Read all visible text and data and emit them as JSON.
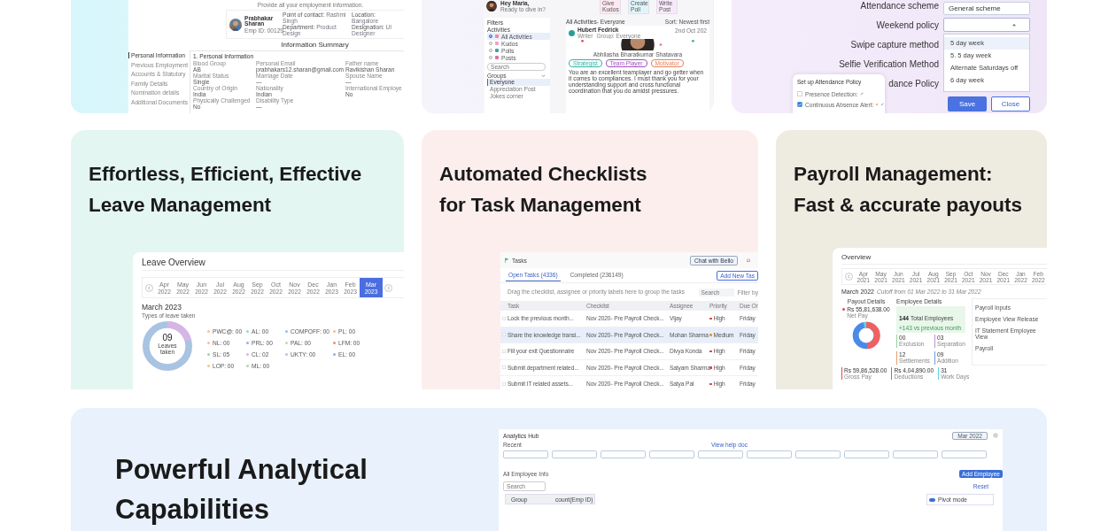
{
  "employment_info": {
    "subtitle": "Provide all your employment information.",
    "employee": {
      "name": "Prabhakar Sharan",
      "emp_id": "Emp ID: 00129",
      "details": [
        {
          "label": "Point of contact:",
          "value": "Rashmi Singh"
        },
        {
          "label": "Location:",
          "value": "Bangalore"
        },
        {
          "label": "Department:",
          "value": "Product Design"
        },
        {
          "label": "Designation:",
          "value": "UI Designer"
        }
      ]
    },
    "heading": "Information Summary",
    "nav": [
      {
        "label": "Personal Information",
        "selected": true
      },
      {
        "label": "Previous Employment",
        "selected": false
      },
      {
        "label": "Accounts & Statutory",
        "selected": false
      },
      {
        "label": "Family Details",
        "selected": false
      },
      {
        "label": "Nomination details",
        "selected": false
      },
      {
        "label": "Additional Documents",
        "selected": false
      }
    ],
    "section": "1. Personal Information",
    "fields": [
      {
        "label": "Blood Group",
        "value": "AB"
      },
      {
        "label": "Personal Email",
        "value": "prabhakars12.sharan@gmail.com"
      },
      {
        "label": "Father name",
        "value": "Ravikishan Sharan"
      },
      {
        "label": "Marital Status",
        "value": "Single"
      },
      {
        "label": "Marriage Date",
        "value": "—"
      },
      {
        "label": "Spouse Name",
        "value": "—"
      },
      {
        "label": "Country of Origin",
        "value": "India"
      },
      {
        "label": "Nationality",
        "value": "Indian"
      },
      {
        "label": "International Employe",
        "value": "No"
      },
      {
        "label": "Physically Challenged",
        "value": "No"
      },
      {
        "label": "Disability Type",
        "value": "—"
      }
    ]
  },
  "activity_feed": {
    "greeting": "Hey Maria,",
    "prompt": "Ready to dive in?",
    "actions": [
      {
        "label": "Give Kudos",
        "color": "#fde9ef"
      },
      {
        "label": "Create Poll",
        "color": "#e0f5fa"
      },
      {
        "label": "Write Post",
        "color": "#f7e8fa"
      }
    ],
    "filters": {
      "title": "Filters",
      "activities_label": "Activities",
      "activities": [
        {
          "label": "All Activities",
          "selected": true,
          "color": "#f08a9a"
        },
        {
          "label": "Kudos",
          "selected": false,
          "color": "#f0a0c0"
        },
        {
          "label": "Polls",
          "selected": false,
          "color": "#3aa8a0"
        },
        {
          "label": "Posts",
          "selected": false,
          "color": "#e070a0"
        }
      ],
      "search_placeholder": "Search",
      "groups_label": "Groups",
      "groups": [
        {
          "label": "Everyone",
          "selected": true
        },
        {
          "label": "Appreciation Post",
          "selected": false
        },
        {
          "label": "Jokes corner",
          "selected": false
        }
      ]
    },
    "feed": {
      "title": "All Activities- Everyone",
      "sort": "Sort: Newest first",
      "post": {
        "author": "Hubert Fedrick",
        "role": "Writer",
        "group": "Group: Everyone",
        "date": "2nd Oct 202",
        "recipient": "Abhilasha Bharatkumar Shatavara",
        "tags": [
          {
            "label": "Strategist",
            "color": "#2fb5a8"
          },
          {
            "label": "Team Player",
            "color": "#a04ec0"
          },
          {
            "label": "Motivator",
            "color": "#e8805a"
          }
        ],
        "message": "You are an excellent teamplayer and go getter when it comes to compliances. I must thank you for your understanding support and cross functional coordination that you do amidst pressures."
      }
    }
  },
  "attendance_settings": {
    "fields": [
      {
        "label": "Attendance scheme",
        "kind": "text",
        "value": "General scheme"
      },
      {
        "label": "Weekend policy",
        "kind": "select",
        "expanded": true,
        "options": [
          {
            "label": "5 day week",
            "selected": true
          },
          {
            "label": "5. 5 day week",
            "selected": false
          },
          {
            "label": "Alternate Saturdays off",
            "selected": false
          },
          {
            "label": "6 day week",
            "selected": false
          }
        ]
      },
      {
        "label": "Swipe capture method",
        "kind": "covered"
      },
      {
        "label": "Selfie Verification Method",
        "kind": "covered"
      },
      {
        "label": "dance Policy",
        "kind": "covered"
      }
    ],
    "buttons": [
      {
        "label": "Save",
        "kind": "primary"
      },
      {
        "label": "Close",
        "kind": "secondary"
      }
    ],
    "popup": {
      "title": "Set up Attendance Policy",
      "items": [
        {
          "label": "Presence Detection:",
          "checked": false
        },
        {
          "label": "Continuous Absence Alert:",
          "checked": true
        }
      ]
    }
  },
  "features": [
    {
      "kind": "leave",
      "title_lines": [
        "Effortless, Efficient, Effective",
        "Leave Management"
      ],
      "panel": {
        "title": "Leave Overview",
        "months": [
          {
            "month": "Apr",
            "year": "2022",
            "selected": false
          },
          {
            "month": "May",
            "year": "2022",
            "selected": false
          },
          {
            "month": "Jun",
            "year": "2022",
            "selected": false
          },
          {
            "month": "Jul",
            "year": "2022",
            "selected": false
          },
          {
            "month": "Aug",
            "year": "2022",
            "selected": false
          },
          {
            "month": "Sep",
            "year": "2022",
            "selected": false
          },
          {
            "month": "Oct",
            "year": "2022",
            "selected": false
          },
          {
            "month": "Nov",
            "year": "2022",
            "selected": false
          },
          {
            "month": "Dec",
            "year": "2022",
            "selected": false
          },
          {
            "month": "Jan",
            "year": "2023",
            "selected": false
          },
          {
            "month": "Feb",
            "year": "2023",
            "selected": false
          },
          {
            "month": "Mar",
            "year": "2023",
            "selected": true
          }
        ],
        "period": "March 2023",
        "subtitle": "Types of leave taken",
        "total": "09",
        "total_label": "Leaves taken",
        "legend": [
          {
            "label": "PWC@: 00",
            "color": "#f2c894"
          },
          {
            "label": "AL: 00",
            "color": "#9ed8a8"
          },
          {
            "label": "COMPOFF: 00",
            "color": "#9bbbe0"
          },
          {
            "label": "PL: 00",
            "color": "#f4b89a"
          },
          {
            "label": "NL: 00",
            "color": "#f3c2a0"
          },
          {
            "label": "PRL: 00",
            "color": "#94b4dc"
          },
          {
            "label": "PAL: 00",
            "color": "#b6e0a6"
          },
          {
            "label": "LFM: 00",
            "color": "#f08a6a"
          },
          {
            "label": "SL: 05",
            "color": "#9ed8a8"
          },
          {
            "label": "CL: 02",
            "color": "#d8b4e6"
          },
          {
            "label": "UKTY: 00",
            "color": "#d8b0e8"
          },
          {
            "label": "EL: 00",
            "color": "#8fb0d8"
          },
          {
            "label": "LOP: 00",
            "color": "#f5c487"
          },
          {
            "label": "ML: 00",
            "color": "#a6dcae"
          }
        ]
      }
    },
    {
      "kind": "tasks",
      "title_lines": [
        "Automated Checklists",
        "for Task Management"
      ],
      "panel": {
        "title": "Tasks",
        "chat_button": "Chat with Bello",
        "tabs": [
          {
            "label": "Open Tasks (4336)",
            "selected": true
          },
          {
            "label": "Completed (236149)",
            "selected": false
          }
        ],
        "add_button": "Add New Tas",
        "hint": "Drag the checklist, assignee or priority labels here to group the tasks",
        "search_placeholder": "Search",
        "filter": "Filter by",
        "columns": [
          "Task",
          "Checklist",
          "Assignee",
          "Priority",
          "Due On"
        ],
        "rows": [
          {
            "task": "Lock the previous month...",
            "checklist": "Nov 2020- Pre Payroll Check...",
            "assignee": "Vijay",
            "priority": "High",
            "color": "#e5484d",
            "due": "Friday",
            "selected": false
          },
          {
            "task": "Share the knowledge transi...",
            "checklist": "Nov 2020- Pre Payroll Check...",
            "assignee": "Mohan Sharma",
            "priority": "Medium",
            "color": "#f0a020",
            "due": "Friday",
            "selected": true
          },
          {
            "task": "Fill your exit Questionnaire",
            "checklist": "Nov 2020- Pre Payroll Check...",
            "assignee": "Divya Konda",
            "priority": "High",
            "color": "#e5484d",
            "due": "Friday",
            "selected": false
          },
          {
            "task": "Submit department related...",
            "checklist": "Nov 2020- Pre Payroll Check...",
            "assignee": "Satyam Sharma",
            "priority": "High",
            "color": "#e5484d",
            "due": "Friday",
            "selected": false
          },
          {
            "task": "Submit IT related assets...",
            "checklist": "Nov 2020- Pre Payroll Check...",
            "assignee": "Satya Pal",
            "priority": "High",
            "color": "#e5484d",
            "due": "Friday",
            "selected": false
          }
        ]
      }
    },
    {
      "kind": "payroll",
      "title_lines": [
        "Payroll Management:",
        "Fast & accurate payouts"
      ],
      "panel": {
        "title": "Overview",
        "months": [
          {
            "month": "Apr",
            "year": "2021",
            "selected": false
          },
          {
            "month": "May",
            "year": "2021",
            "selected": false
          },
          {
            "month": "Jun",
            "year": "2021",
            "selected": false
          },
          {
            "month": "Jul",
            "year": "2021",
            "selected": false
          },
          {
            "month": "Aug",
            "year": "2021",
            "selected": false
          },
          {
            "month": "Sep",
            "year": "2021",
            "selected": false
          },
          {
            "month": "Oct",
            "year": "2021",
            "selected": false
          },
          {
            "month": "Nov",
            "year": "2021",
            "selected": false
          },
          {
            "month": "Dec",
            "year": "2021",
            "selected": false
          },
          {
            "month": "Jan",
            "year": "2022",
            "selected": false
          },
          {
            "month": "Feb",
            "year": "2022",
            "selected": false
          }
        ],
        "period": "March 2022",
        "cutoff": "Cutoff from 01 Mar 2022 to 31 Mar 2022",
        "payout_title": "Payout Details",
        "net": "Rs 55,81,638.00",
        "net_label": "Net Pay",
        "totals": [
          {
            "value": "Rs 59,86,528.00",
            "label": "Gross Pay",
            "color": "#e5484d"
          },
          {
            "value": "Rs 4,04,890.00",
            "label": "Deductions",
            "color": "#4a8ae8"
          },
          {
            "value": "31",
            "label": "Work Days",
            "color": "#5fd3e6"
          }
        ],
        "employee_title": "Employee Details",
        "total": "144",
        "total_label": "Total Employees",
        "change": "+143 vs previous month",
        "stats": [
          {
            "value": "00",
            "label": "Exclusion",
            "color": "#8fd4a0"
          },
          {
            "value": "03",
            "label": "Separation",
            "color": "#c58fd8"
          },
          {
            "value": "12",
            "label": "Settlements",
            "color": "#e5a06a"
          },
          {
            "value": "09",
            "label": "Addition",
            "color": "#6a9de0"
          }
        ],
        "links": [
          "Payroll Inputs",
          "Employee View Release",
          "IT Statement Employee View",
          "Payroll"
        ]
      }
    }
  ],
  "analytics": {
    "title_lines": [
      "Powerful Analytical",
      "Capabilities"
    ],
    "hub": {
      "title": "Analytics Hub",
      "period": "Mar 2022",
      "recent_label": "Recent",
      "help_link": "View help doc",
      "table_title": "All Employee Info",
      "add_button": "Add Employee",
      "search_placeholder": "Search",
      "reset": "Reset",
      "columns": [
        "Group",
        "count(Emp ID)"
      ],
      "pivot_label": "Pivot mode",
      "pivot_on": true
    }
  }
}
